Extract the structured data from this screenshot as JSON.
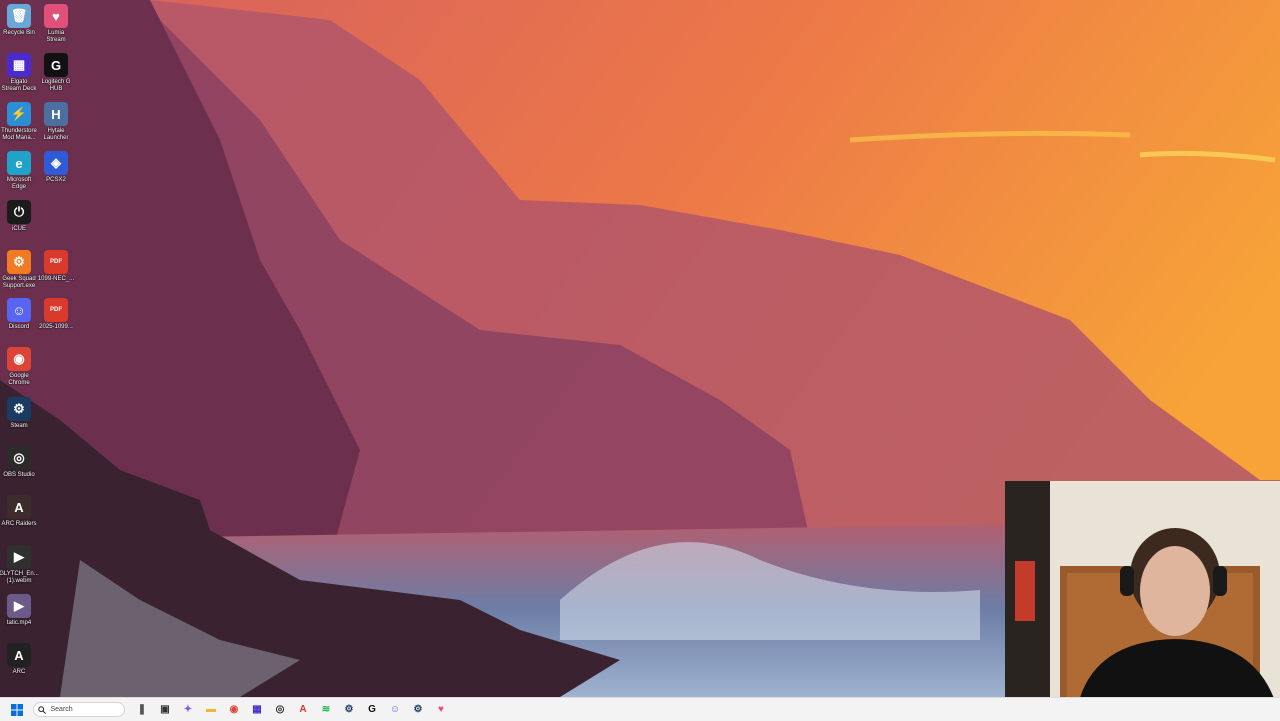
{
  "desktop": {
    "icons": [
      {
        "label": "Recycle Bin",
        "icon": "recycle-bin-icon",
        "color": "#6aa7d8"
      },
      {
        "label": "Lumia\nStream",
        "icon": "lumia-stream-icon",
        "color": "#e0507a"
      },
      {
        "label": "Elgato\nStream Deck",
        "icon": "stream-deck-icon",
        "color": "#4b2bd1"
      },
      {
        "label": "Logitech G\nHUB",
        "icon": "logitech-ghub-icon",
        "color": "#111111"
      },
      {
        "label": "Thunderstore\nMod Mana...",
        "icon": "thunderstore-icon",
        "color": "#2a8fd6"
      },
      {
        "label": "Hytale\nLauncher",
        "icon": "hytale-launcher-icon",
        "color": "#4a6fa0"
      },
      {
        "label": "Microsoft\nEdge",
        "icon": "edge-icon",
        "color": "#1fa3c9"
      },
      {
        "label": "PCSX2",
        "icon": "pcsx2-icon",
        "color": "#2f5bd8"
      },
      {
        "label": "iCUE",
        "icon": "icue-icon",
        "color": "#1b1b1b"
      },
      {
        "label": "Geek Squad\nSupport.exe",
        "icon": "geek-squad-icon",
        "color": "#f07b22"
      },
      {
        "label": "1099-NEC_...",
        "icon": "pdf-file-icon",
        "color": "#d93a2b"
      },
      {
        "label": "Discord",
        "icon": "discord-icon",
        "color": "#5865f2"
      },
      {
        "label": "2025-1099...",
        "icon": "pdf-file-icon",
        "color": "#d93a2b"
      },
      {
        "label": "Google\nChrome",
        "icon": "chrome-icon",
        "color": "#db4437"
      },
      {
        "label": "Steam",
        "icon": "steam-icon",
        "color": "#1b3b63"
      },
      {
        "label": "OBS Studio",
        "icon": "obs-studio-icon",
        "color": "#2b2b2b"
      },
      {
        "label": "ARC Raiders",
        "icon": "arc-raiders-icon",
        "color": "#3d2c2c"
      },
      {
        "label": "GLYTCH_En...\n(1).webm",
        "icon": "video-file-icon",
        "color": "#303030"
      },
      {
        "label": "tatic.mp4",
        "icon": "video-file-icon",
        "color": "#6b5a8a"
      },
      {
        "label": "ARC",
        "icon": "arc-icon",
        "color": "#222222"
      }
    ]
  },
  "taskbar": {
    "search_placeholder": "Search",
    "apps": [
      "start-icon",
      "file-manager-icon",
      "copilot-icon",
      "file-explorer-icon",
      "chrome-icon",
      "stream-deck-icon",
      "obs-studio-icon",
      "acrobat-icon",
      "spotify-icon",
      "steam-icon",
      "logitech-ghub-icon",
      "discord-icon",
      "steam-icon",
      "lumia-stream-icon"
    ]
  },
  "colors": {
    "sky_top": "#e8725a",
    "sky_sun": "#f6a53a",
    "cliff": "#7a3a55",
    "sea": "#6d7fa4"
  }
}
